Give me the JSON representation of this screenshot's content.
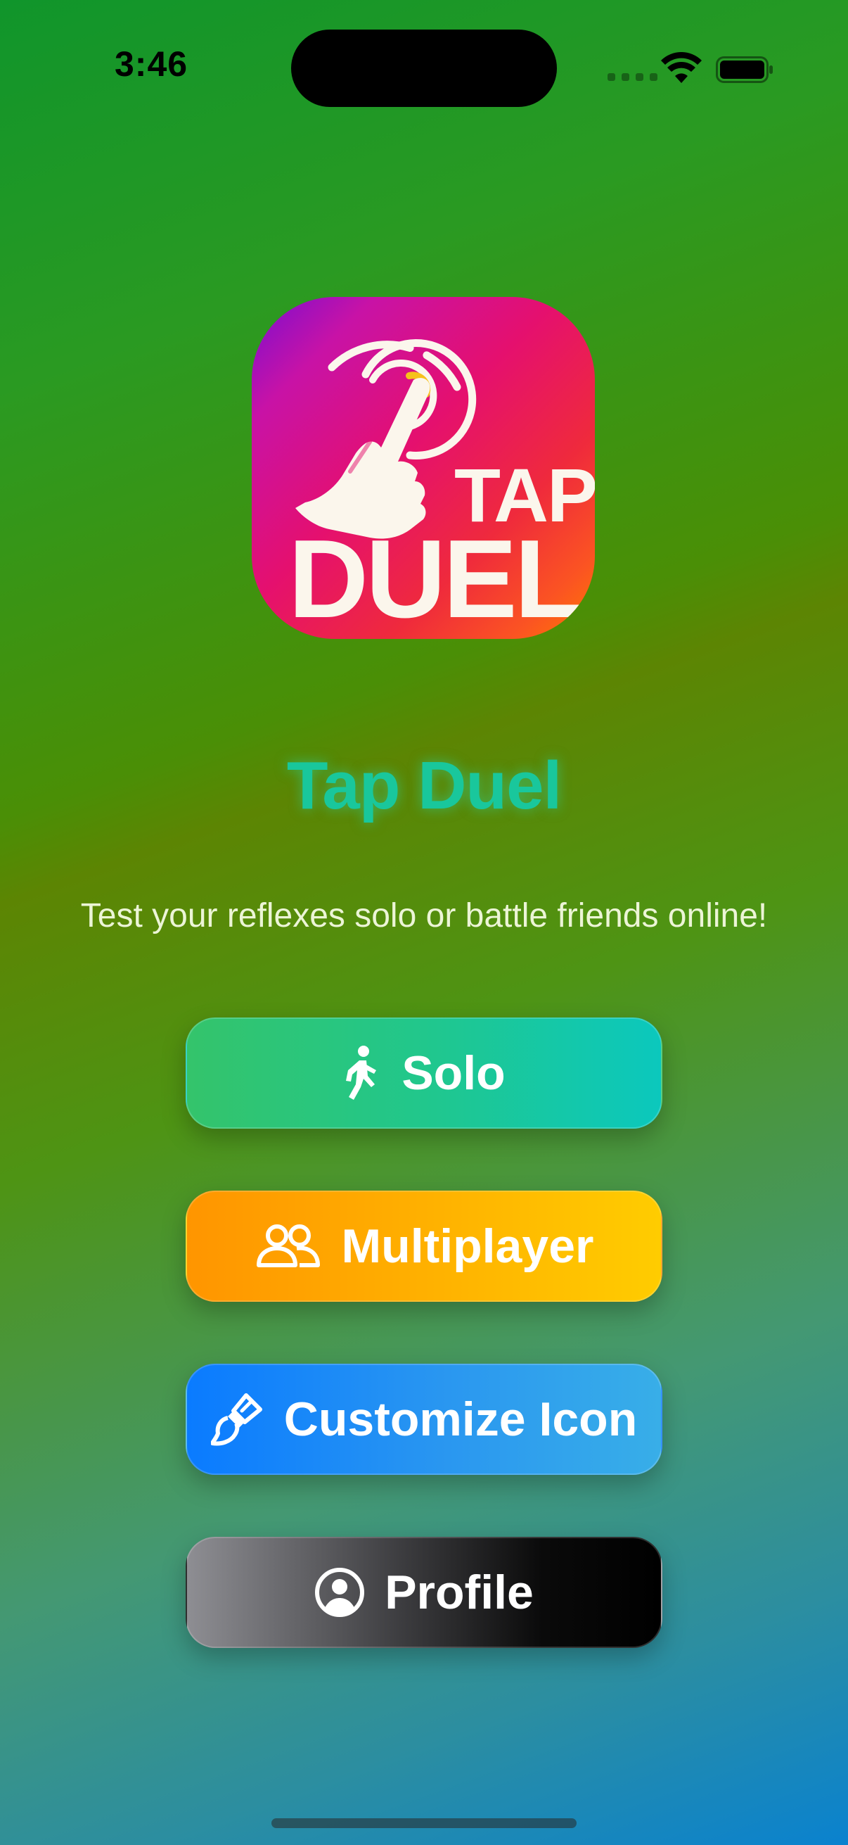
{
  "status_bar": {
    "time": "3:46"
  },
  "logo": {
    "word_top": "TAP",
    "word_bottom": "DUEL",
    "icon": "tap-hand-icon"
  },
  "title": "Tap Duel",
  "tagline": "Test your reflexes solo or battle friends online!",
  "menu": {
    "solo": {
      "label": "Solo",
      "icon": "figure-walk-icon",
      "color": "#34c46b"
    },
    "multiplayer": {
      "label": "Multiplayer",
      "icon": "two-people-icon",
      "color": "#ff9500"
    },
    "customize": {
      "label": "Customize Icon",
      "icon": "paintbrush-icon",
      "color": "#0a7bff"
    },
    "profile": {
      "label": "Profile",
      "icon": "person-circle-icon",
      "color": "#000000"
    }
  },
  "colors": {
    "title": "#19c79c",
    "tagline": "#ecf5d6"
  }
}
